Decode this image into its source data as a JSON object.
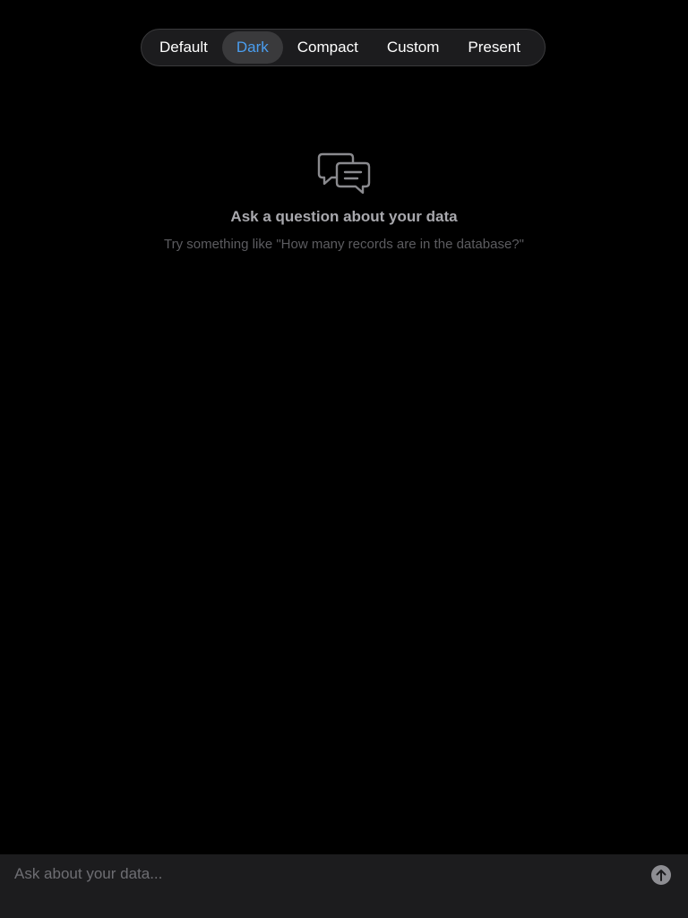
{
  "segmented_control": {
    "options": [
      {
        "label": "Default"
      },
      {
        "label": "Dark"
      },
      {
        "label": "Compact"
      },
      {
        "label": "Custom"
      },
      {
        "label": "Present"
      }
    ],
    "selected": "Dark"
  },
  "empty_state": {
    "icon": "chat-bubbles-icon",
    "title": "Ask a question about your data",
    "subtitle": "Try something like \"How many records are in the database?\""
  },
  "composer": {
    "placeholder": "Ask about your data...",
    "send_icon": "arrow-up-icon"
  },
  "colors": {
    "background": "#000000",
    "accent": "#4a9ef0",
    "segment_bg": "#1c1c1e",
    "segment_active_bg": "#3a3a3c",
    "composer_bg": "#1c1c1e"
  }
}
